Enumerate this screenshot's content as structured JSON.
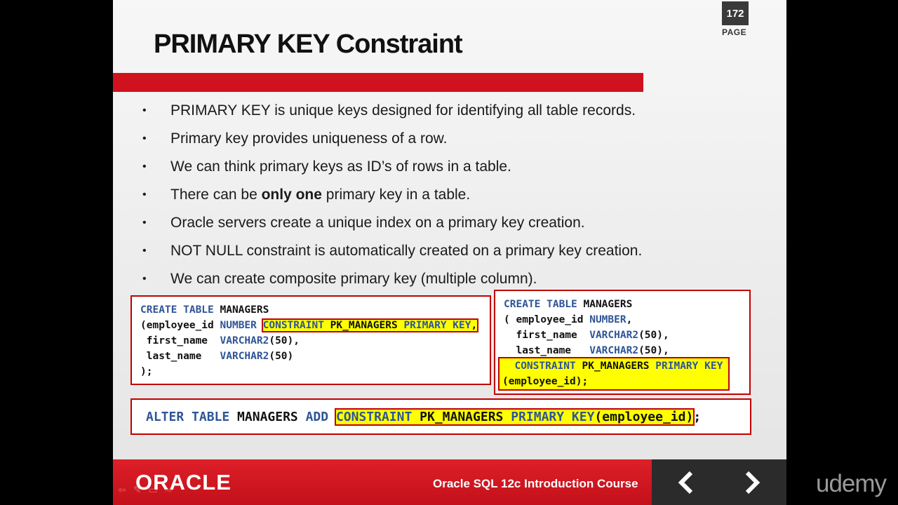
{
  "page": {
    "number": "172",
    "label": "PAGE"
  },
  "title": "PRIMARY KEY Constraint",
  "bullets": [
    {
      "pre": "PRIMARY KEY is unique keys designed for identifying all table records.",
      "bold": "",
      "post": ""
    },
    {
      "pre": "Primary key provides uniqueness of a row.",
      "bold": "",
      "post": ""
    },
    {
      "pre": "We can think primary keys as ID’s of rows in a table.",
      "bold": "",
      "post": ""
    },
    {
      "pre": "There can be ",
      "bold": "only one",
      "post": " primary key in a table."
    },
    {
      "pre": "Oracle servers create a unique index on a primary key creation.",
      "bold": "",
      "post": ""
    },
    {
      "pre": "NOT NULL constraint is automatically  created on a primary key creation.",
      "bold": "",
      "post": ""
    },
    {
      "pre": "We can create composite primary key (multiple column).",
      "bold": "",
      "post": ""
    }
  ],
  "code1": {
    "l1_kw": "CREATE TABLE",
    "l1_rest": " MANAGERS",
    "l2_a": "(employee_id ",
    "l2_kw": "NUMBER",
    "l2_sp": " ",
    "l2_hl_kw1": "CONSTRAINT",
    "l2_hl_mid": " PK_MANAGERS ",
    "l2_hl_kw2": "PRIMARY KEY",
    "l2_hl_end": ",",
    "l3_a": " first_name  ",
    "l3_kw": "VARCHAR2",
    "l3_b": "(50),",
    "l4_a": " last_name   ",
    "l4_kw": "VARCHAR2",
    "l4_b": "(50)",
    "l5": ");"
  },
  "code2": {
    "l1_kw": "CREATE TABLE",
    "l1_rest": " MANAGERS",
    "l2_a": "( employee_id ",
    "l2_kw": "NUMBER",
    "l2_b": ",",
    "l3_a": "  first_name  ",
    "l3_kw": "VARCHAR2",
    "l3_b": "(50),",
    "l4_a": "  last_name   ",
    "l4_kw": "VARCHAR2",
    "l4_b": "(50),",
    "l5_kw1": "CONSTRAINT",
    "l5_mid": " PK_MANAGERS ",
    "l5_kw2": "PRIMARY KEY",
    "l6": "(employee_id);"
  },
  "code3": {
    "kw1": "ALTER TABLE",
    "mid1": " MANAGERS ",
    "kw2": "ADD",
    "sp": " ",
    "hl_kw1": "CONSTRAINT",
    "hl_mid": " PK_MANAGERS ",
    "hl_kw2": "PRIMARY KEY",
    "hl_end": "(employee_id)",
    "end": ";"
  },
  "footer": {
    "logo": "ORACLE",
    "course": "Oracle SQL 12c Introduction Course"
  },
  "brand": "udemy",
  "colors": {
    "red": "#d0121e",
    "keyword": "#2f5597",
    "highlight": "#ffff00"
  }
}
